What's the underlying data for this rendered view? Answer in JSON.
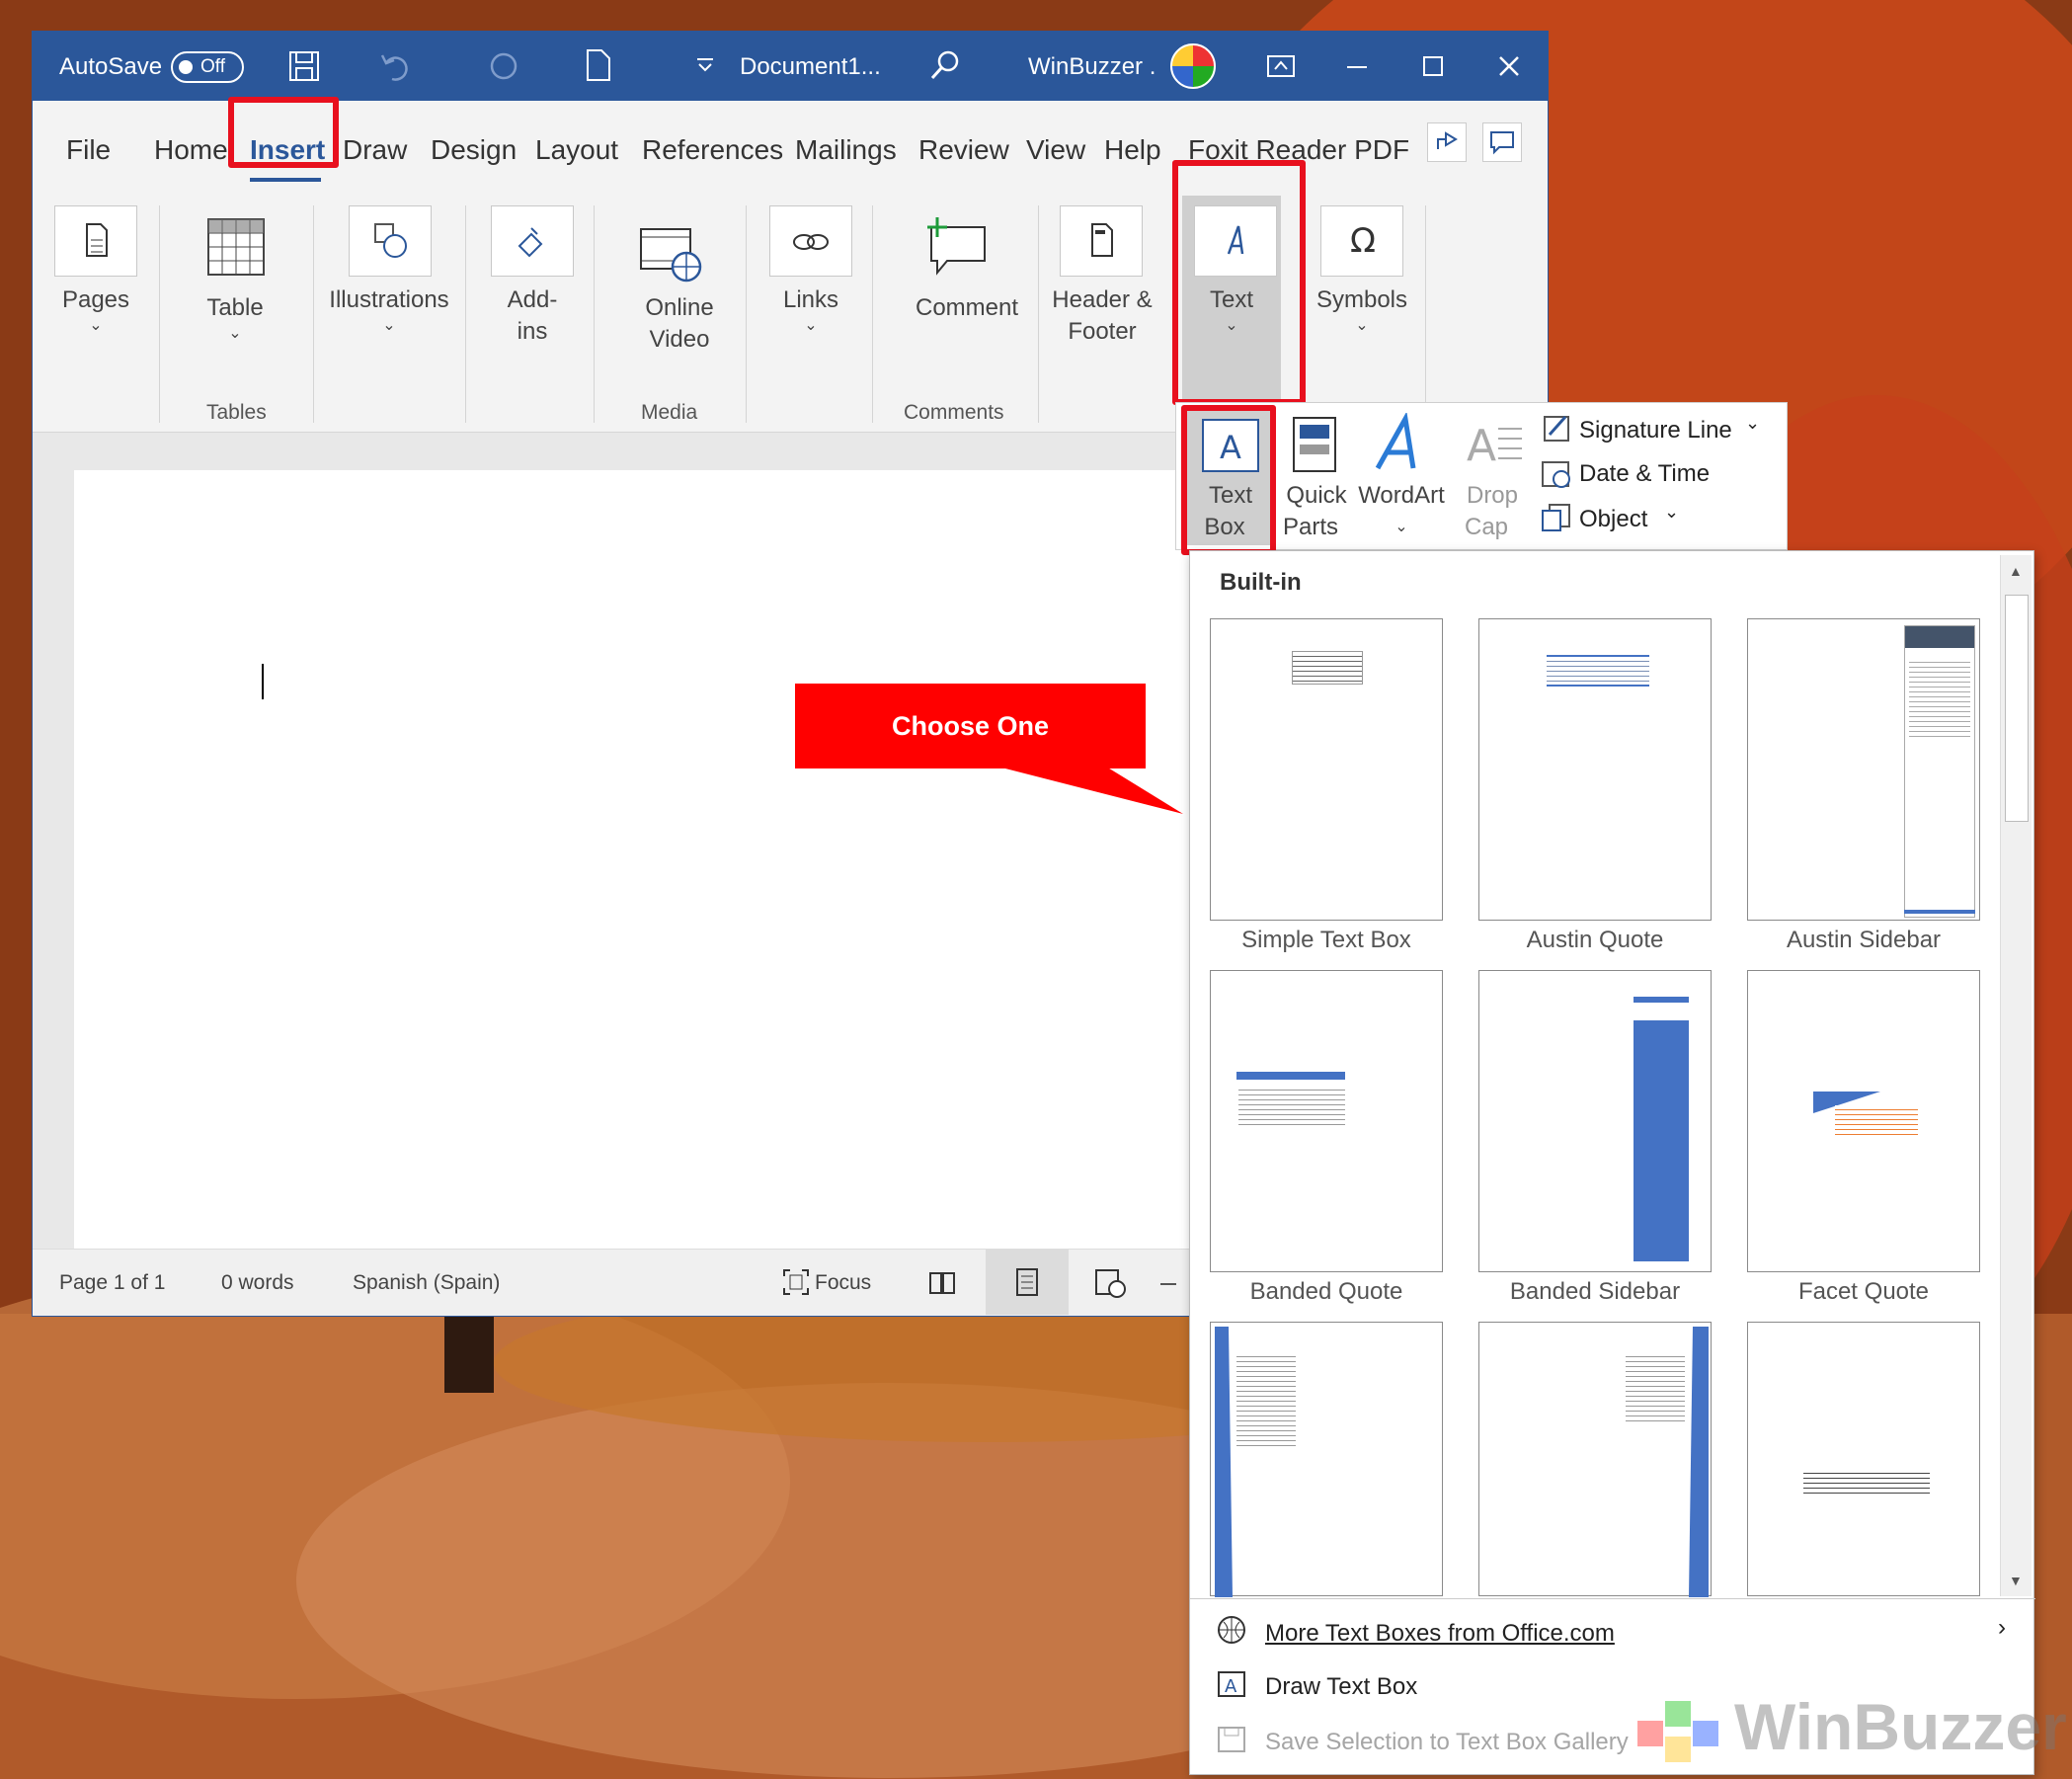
{
  "titlebar": {
    "autosave": "AutoSave",
    "toggle": "Off",
    "document": "Document1...",
    "user": "WinBuzzer ."
  },
  "menu": {
    "tabs": [
      "File",
      "Home",
      "Insert",
      "Draw",
      "Design",
      "Layout",
      "References",
      "Mailings",
      "Review",
      "View",
      "Help",
      "Foxit Reader PDF"
    ]
  },
  "ribbon": {
    "pages": "Pages",
    "table": "Table",
    "illustrations": "Illustrations",
    "addins1": "Add-",
    "addins2": "ins",
    "online1": "Online",
    "online2": "Video",
    "links": "Links",
    "comment": "Comment",
    "header1": "Header &",
    "header2": "Footer",
    "text": "Text",
    "symbols": "Symbols",
    "groups": {
      "tables": "Tables",
      "media": "Media",
      "comments": "Comments"
    }
  },
  "textgroup": {
    "textbox1": "Text",
    "textbox2": "Box",
    "quick1": "Quick",
    "quick2": "Parts",
    "wordart": "WordArt",
    "drop1": "Drop",
    "drop2": "Cap",
    "signature": "Signature Line",
    "datetime": "Date & Time",
    "object": "Object"
  },
  "gallery": {
    "heading": "Built-in",
    "items": [
      "Simple Text Box",
      "Austin Quote",
      "Austin Sidebar",
      "Banded Quote",
      "Banded Sidebar",
      "Facet Quote"
    ],
    "more": "More Text Boxes from Office.com",
    "draw": "Draw Text Box",
    "save": "Save Selection to Text Box Gallery"
  },
  "status": {
    "page": "Page 1 of 1",
    "words": "0 words",
    "lang": "Spanish (Spain)",
    "focus": "Focus"
  },
  "callout": "Choose One",
  "watermark": "WinBuzzer",
  "colors": {
    "word_blue": "#2b579a",
    "highlight": "#e8101e",
    "accent": "#4472c4"
  }
}
